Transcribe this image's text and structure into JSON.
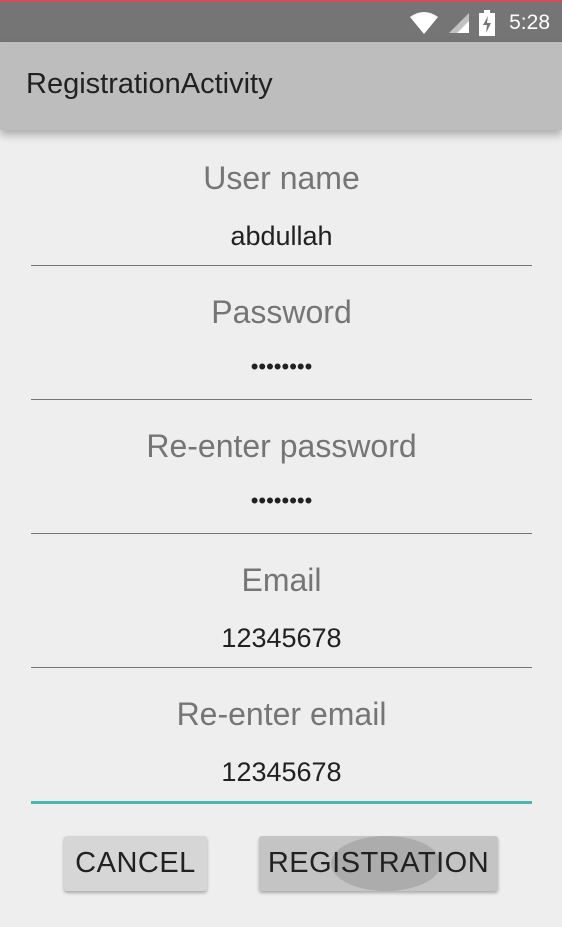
{
  "status_bar": {
    "time": "5:28",
    "icons": [
      "wifi-icon",
      "signal-icon",
      "battery-charging-icon"
    ]
  },
  "app_bar": {
    "title": "RegistrationActivity"
  },
  "form": {
    "fields": [
      {
        "label": "User name",
        "value": "abdullah",
        "type": "text"
      },
      {
        "label": "Password",
        "value": "••••••••",
        "type": "password"
      },
      {
        "label": "Re-enter password",
        "value": "••••••••",
        "type": "password"
      },
      {
        "label": "Email",
        "value": "12345678",
        "type": "text"
      },
      {
        "label": "Re-enter email",
        "value": "12345678",
        "type": "text",
        "focused": true
      }
    ]
  },
  "buttons": {
    "cancel_label": "CANCEL",
    "register_label": "REGISTRATION"
  },
  "colors": {
    "status_bar": "#757575",
    "app_bar": "#bdbdbd",
    "background": "#eeeeee",
    "accent": "#4db6ac",
    "top_edge": "#d94b55"
  }
}
